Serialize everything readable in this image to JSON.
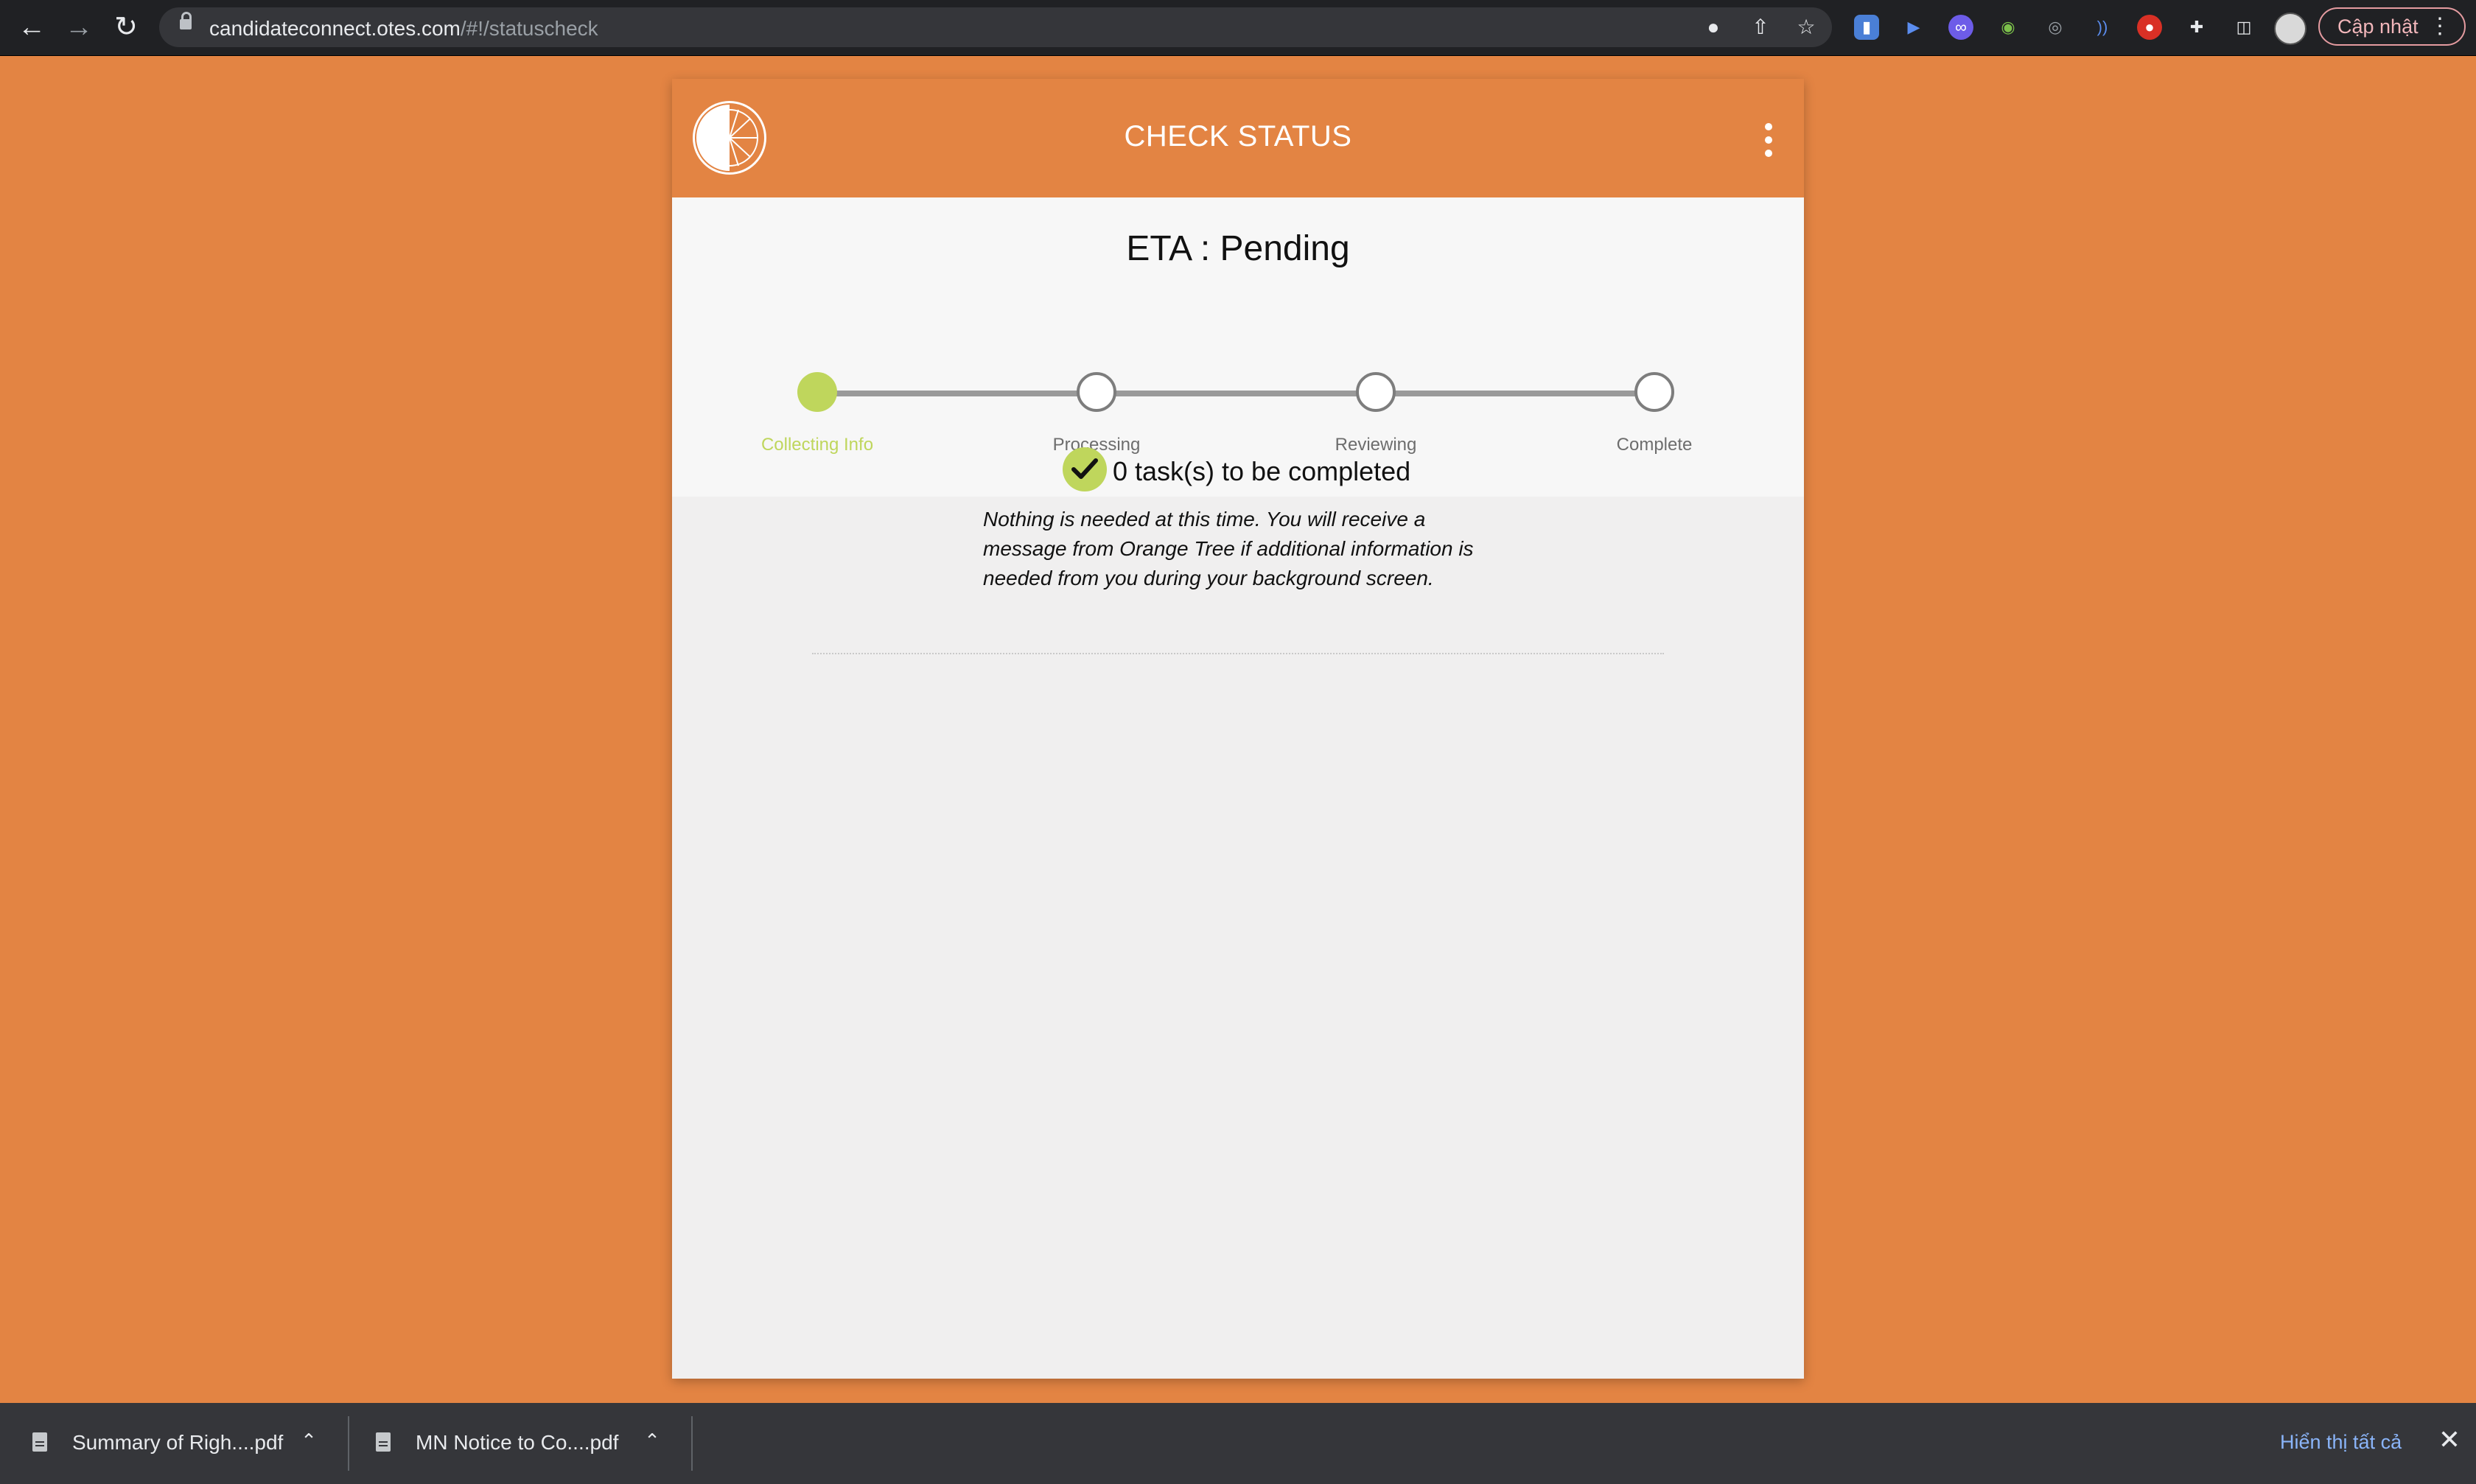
{
  "browser": {
    "url_host": "candidateconnect.otes.com",
    "url_path": "/#!/statuscheck",
    "update_label": "Cập nhật",
    "nav": {
      "back_icon": "arrow-left-icon",
      "forward_icon": "arrow-right-icon",
      "reload_icon": "reload-icon"
    },
    "omnibox_icons": [
      "location-pin-icon",
      "share-icon",
      "star-icon"
    ],
    "extensions": [
      "bookmark-ext-icon",
      "cursor-ext-icon",
      "infinity-ext-icon",
      "drop-ext-icon",
      "target-ext-icon",
      "wave-ext-icon",
      "red-ext-icon",
      "puzzle-icon",
      "side-panel-icon"
    ]
  },
  "app": {
    "title": "CHECK STATUS",
    "eta_text": "ETA : Pending",
    "steps": [
      {
        "label": "Collecting Info",
        "state": "active"
      },
      {
        "label": "Processing",
        "state": "pending"
      },
      {
        "label": "Reviewing",
        "state": "pending"
      },
      {
        "label": "Complete",
        "state": "pending"
      }
    ],
    "tasks_text": "0 task(s) to be completed",
    "note_text": "Nothing is needed at this time. You will receive a message from Orange Tree if additional information is needed from you during your background screen."
  },
  "downloads": {
    "items": [
      {
        "name": "Summary of Righ....pdf"
      },
      {
        "name": "MN Notice to Co....pdf"
      }
    ],
    "show_all": "Hiển thị tất cả"
  },
  "colors": {
    "brand_orange": "#e38443",
    "active_green": "#bfd65c",
    "chrome_dark": "#202124"
  }
}
